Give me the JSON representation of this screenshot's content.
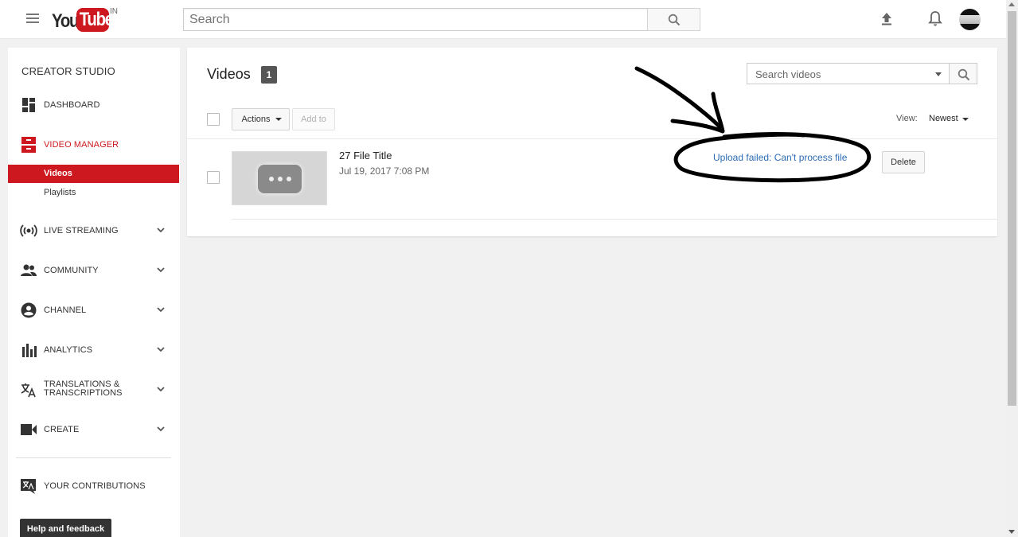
{
  "header": {
    "logo_you": "You",
    "logo_tube": "Tube",
    "logo_country": "IN",
    "search_placeholder": "Search"
  },
  "sidebar": {
    "title": "CREATOR STUDIO",
    "items": [
      {
        "label": "DASHBOARD",
        "icon": "dashboard-icon"
      },
      {
        "label": "VIDEO MANAGER",
        "icon": "video-manager-icon",
        "active": true
      },
      {
        "label": "LIVE STREAMING",
        "icon": "live-streaming-icon"
      },
      {
        "label": "COMMUNITY",
        "icon": "community-icon"
      },
      {
        "label": "CHANNEL",
        "icon": "channel-icon"
      },
      {
        "label": "ANALYTICS",
        "icon": "analytics-icon"
      },
      {
        "label": "TRANSLATIONS &",
        "label2": "TRANSCRIPTIONS",
        "icon": "translate-icon"
      },
      {
        "label": "CREATE",
        "icon": "create-icon"
      },
      {
        "label": "YOUR CONTRIBUTIONS",
        "icon": "contributions-icon"
      }
    ],
    "subitems": [
      {
        "label": "Videos",
        "active": true
      },
      {
        "label": "Playlists"
      }
    ],
    "help": "Help and feedback"
  },
  "main": {
    "title": "Videos",
    "count": "1",
    "search_placeholder": "Search videos",
    "actions_label": "Actions",
    "add_to_label": "Add to",
    "view_label": "View:",
    "view_value": "Newest",
    "video": {
      "title": "27 File Title",
      "date": "Jul 19, 2017 7:08 PM",
      "status": "Upload failed: Can't process file",
      "delete_label": "Delete"
    }
  },
  "colors": {
    "brand_red": "#cc181e",
    "link_blue": "#2c6bb5"
  }
}
